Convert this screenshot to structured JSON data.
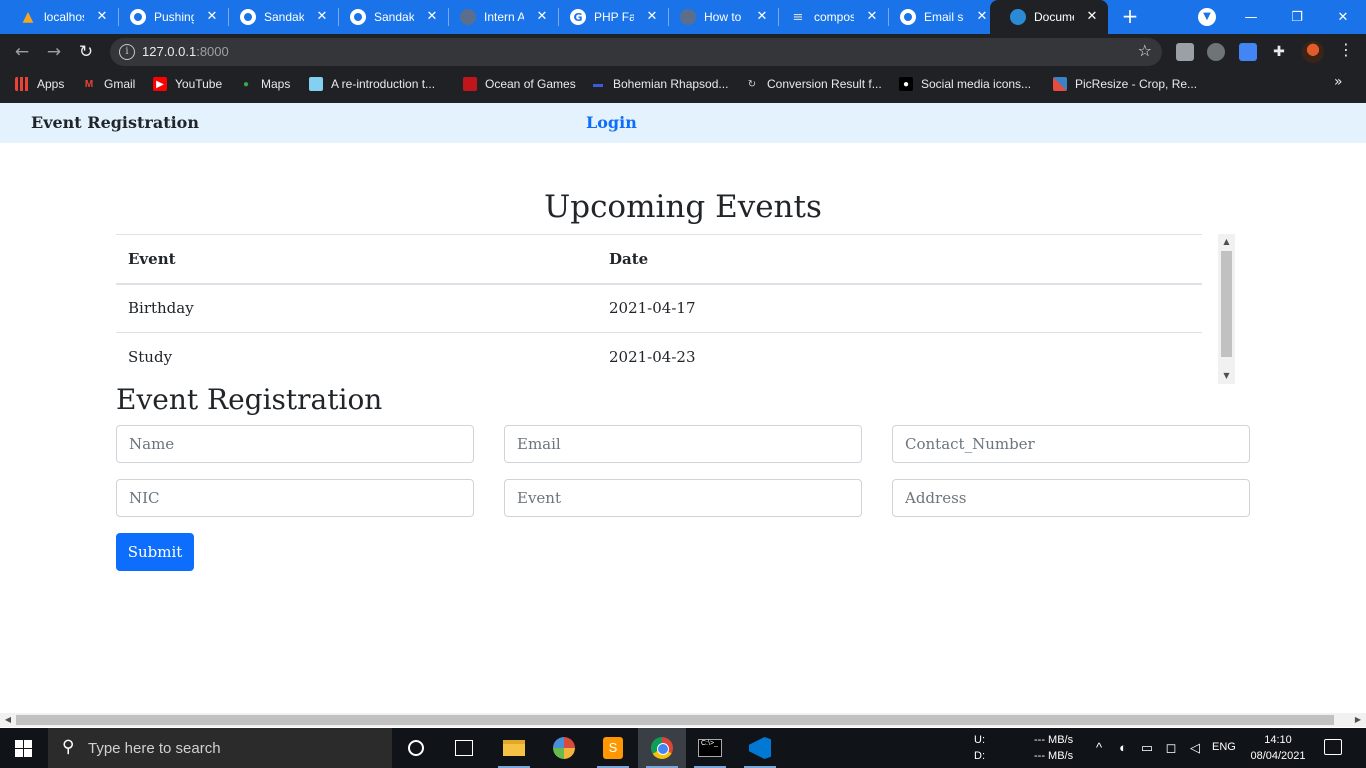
{
  "browser": {
    "tabs": [
      {
        "title": "localhost",
        "icon": "xampp-icon"
      },
      {
        "title": "Pushing",
        "icon": "github-icon"
      },
      {
        "title": "Sandaka",
        "icon": "github-icon"
      },
      {
        "title": "Sandaka",
        "icon": "github-icon"
      },
      {
        "title": "Intern At",
        "icon": "globe-icon"
      },
      {
        "title": "PHP Fata",
        "icon": "google-icon"
      },
      {
        "title": "How to S",
        "icon": "globe-icon"
      },
      {
        "title": "compose",
        "icon": "stackoverflow-icon"
      },
      {
        "title": "Email se",
        "icon": "github-icon"
      },
      {
        "title": "Docume",
        "icon": "edge-icon"
      }
    ],
    "tab_close": "✕",
    "new_tab": "+",
    "window_controls": {
      "minimize": "—",
      "maximize": "❐",
      "close": "✕"
    },
    "url_host": "127.0.0.1",
    "url_port": ":8000",
    "bookmarks": [
      {
        "label": "Apps",
        "icon": "apps-icon"
      },
      {
        "label": "Gmail",
        "icon": "gmail-icon"
      },
      {
        "label": "YouTube",
        "icon": "youtube-icon"
      },
      {
        "label": "Maps",
        "icon": "maps-icon"
      },
      {
        "label": "A re-introduction t...",
        "icon": "mdn-icon"
      },
      {
        "label": "Ocean of Games",
        "icon": "ocean-of-games-icon"
      },
      {
        "label": "Bohemian Rhapsod...",
        "icon": "bohemian-icon"
      },
      {
        "label": "Conversion Result f...",
        "icon": "conversion-icon"
      },
      {
        "label": "Social media icons...",
        "icon": "social-icon"
      },
      {
        "label": "PicResize - Crop, Re...",
        "icon": "picresize-icon"
      }
    ],
    "bookmarks_more": "»"
  },
  "page": {
    "brand": "Event Registration",
    "nav_login": "Login",
    "events_title": "Upcoming Events",
    "table": {
      "headers": [
        "Event",
        "Date"
      ],
      "rows": [
        [
          "Birthday",
          "2021-04-17"
        ],
        [
          "Study",
          "2021-04-23"
        ]
      ]
    },
    "form_title": "Event Registration",
    "fields": {
      "name": "Name",
      "email": "Email",
      "contact": "Contact_Number",
      "nic": "NIC",
      "event": "Event",
      "address": "Address"
    },
    "submit": "Submit"
  },
  "taskbar": {
    "search_placeholder": "Type here to search",
    "net_u_label": "U:",
    "net_d_label": "D:",
    "net_u_value": "--- MB/s",
    "net_d_value": "--- MB/s",
    "language": "ENG",
    "time": "14:10",
    "date": "08/04/2021"
  },
  "colors": {
    "chrome_tab_strip": "#1a73e8",
    "chrome_toolbar": "#202124",
    "navbar_bg": "#e3f2fd",
    "link": "#0d6efd",
    "button_primary": "#0d6efd",
    "taskbar_bg": "#101418"
  }
}
